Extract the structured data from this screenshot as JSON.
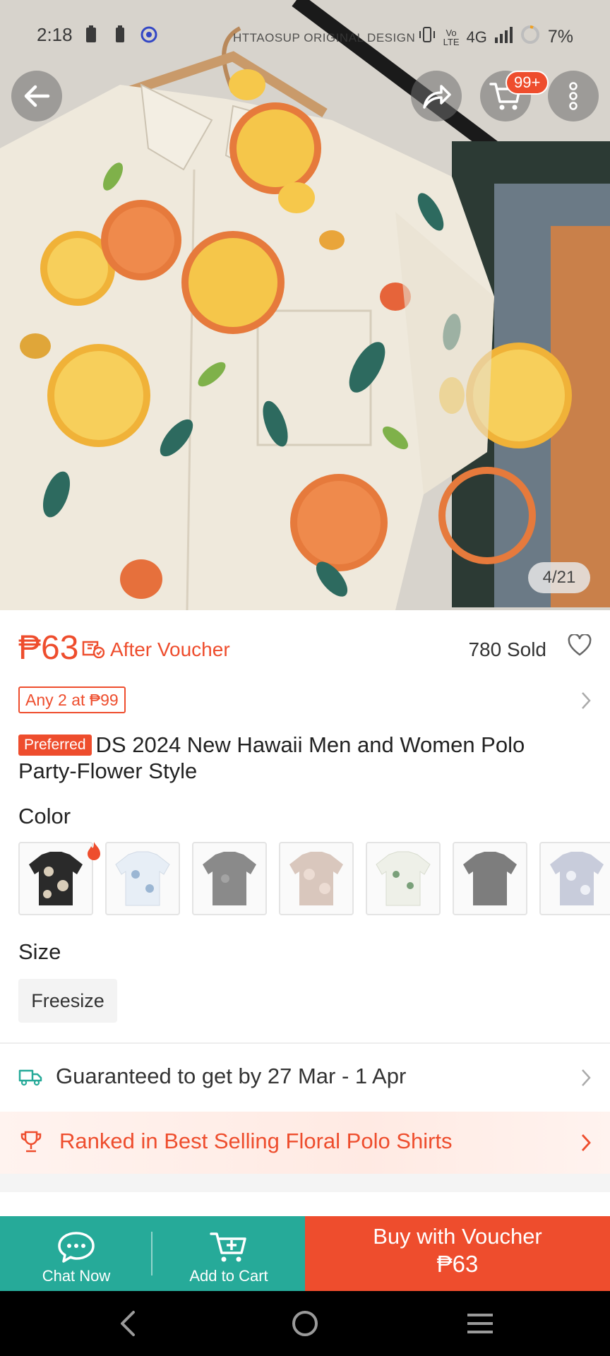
{
  "status_bar": {
    "time": "2:18",
    "network": "4G",
    "battery": "7%",
    "watermark": "HTTAOSUP ORIGINAL DESIGN"
  },
  "gallery": {
    "counter": "4/21"
  },
  "header": {
    "cart_badge": "99+"
  },
  "product": {
    "price": "₱63",
    "after_voucher_label": "After Voucher",
    "sold": "780 Sold",
    "promo_tag": "Any 2 at ₱99",
    "preferred_badge": "Preferred",
    "title": "DS 2024 New Hawaii Men and Women Polo Party-Flower Style"
  },
  "variations": {
    "color_label": "Color",
    "swatch_colors": [
      "#2a2a2a",
      "#e7eef6",
      "#8a8a8a",
      "#d9c7bd",
      "#eef0e8",
      "#7d7d7d",
      "#c8ccdb"
    ],
    "size_label": "Size",
    "size_option": "Freesize"
  },
  "shipping": {
    "text": "Guaranteed to get by 27 Mar - 1 Apr"
  },
  "ranking": {
    "text": "Ranked in Best Selling Floral Polo Shirts"
  },
  "bottom_bar": {
    "chat_label": "Chat Now",
    "cart_label": "Add to Cart",
    "buy_line1": "Buy with Voucher",
    "buy_line2": "₱63"
  },
  "colors": {
    "accent": "#ee4d2d",
    "teal": "#26aa99",
    "shipping_icon": "#26aa99"
  },
  "icons": [
    "back-arrow-icon",
    "share-icon",
    "cart-icon",
    "more-icon",
    "voucher-icon",
    "heart-icon",
    "chevron-right-icon",
    "hot-fire-icon",
    "truck-icon",
    "trophy-icon",
    "chat-icon",
    "add-cart-icon",
    "nav-back-icon",
    "nav-home-icon",
    "nav-menu-icon"
  ]
}
